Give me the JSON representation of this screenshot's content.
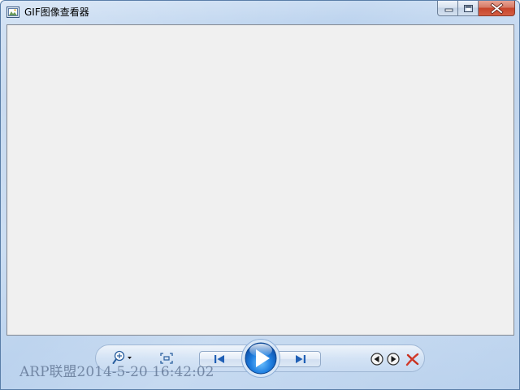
{
  "window": {
    "title": "GIF图像查看器",
    "caption_buttons": [
      "minimize-icon",
      "maximize-icon",
      "close-icon"
    ]
  },
  "canvas": {
    "background": "#f0f0f0"
  },
  "toolbar": {
    "items": [
      "zoom-icon",
      "fit-to-window-icon",
      "previous-icon",
      "play-icon",
      "next-icon",
      "rotate-left-icon",
      "rotate-right-icon",
      "delete-icon"
    ]
  },
  "watermark": {
    "text": "ARP联盟2014-5-20 16:42:02"
  },
  "colors": {
    "close_button": "#c7442a",
    "play_button": "#1f7fe0",
    "delete_icon": "#d23a2a"
  }
}
